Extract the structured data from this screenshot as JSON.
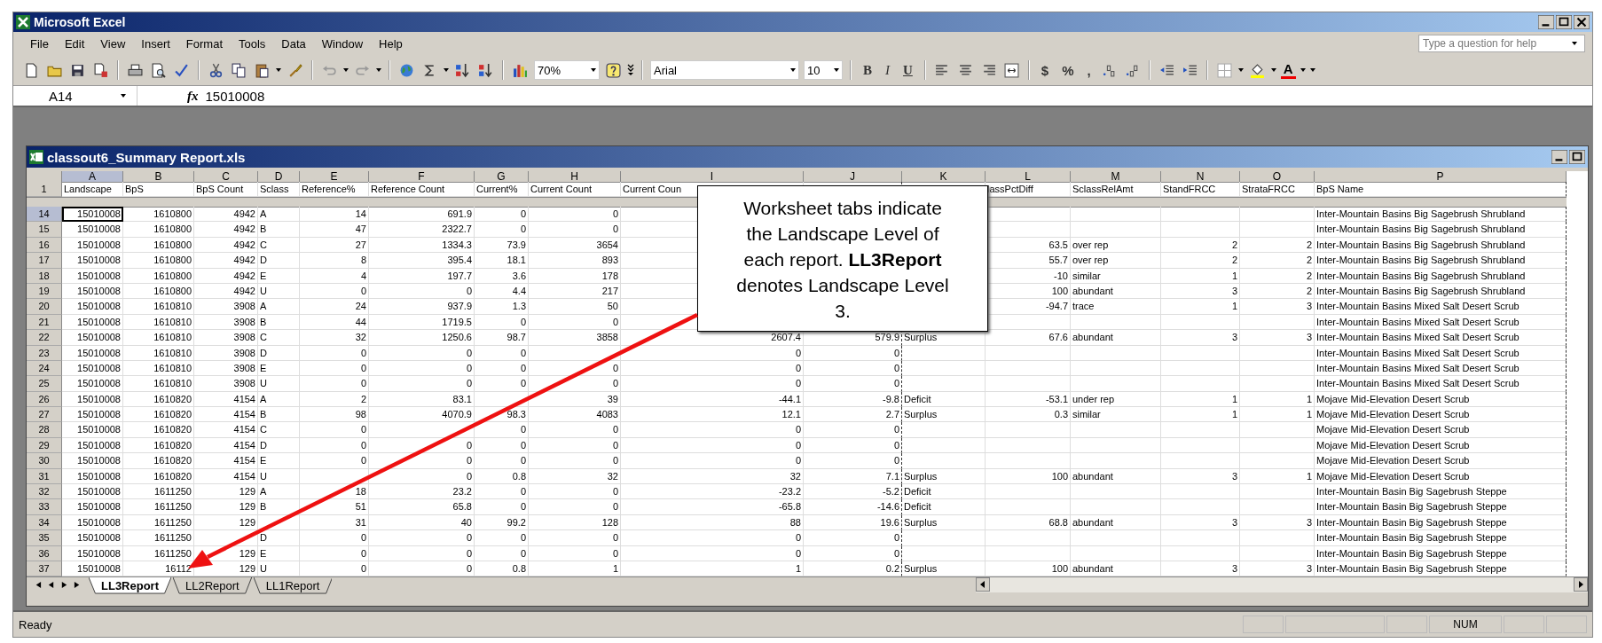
{
  "window": {
    "title": "Microsoft Excel"
  },
  "menu": [
    "File",
    "Edit",
    "View",
    "Insert",
    "Format",
    "Tools",
    "Data",
    "Window",
    "Help"
  ],
  "help_box": {
    "placeholder": "Type a question for help"
  },
  "toolbar": {
    "zoom": "70%",
    "font": "Arial",
    "font_size": "10",
    "style_buttons": [
      "B",
      "I",
      "U"
    ],
    "number_buttons": [
      "$",
      "%",
      ","
    ],
    "font_color_label": "A"
  },
  "formula_bar": {
    "name_box": "A14",
    "function_label": "fx",
    "value": "15010008"
  },
  "workbook": {
    "title": "classout6_Summary Report.xls",
    "columns": [
      {
        "letter": "A",
        "selected": true
      },
      {
        "letter": "B",
        "selected": false
      },
      {
        "letter": "C",
        "selected": false
      },
      {
        "letter": "D",
        "selected": false
      },
      {
        "letter": "E",
        "selected": false
      },
      {
        "letter": "F",
        "selected": false
      },
      {
        "letter": "G",
        "selected": false
      },
      {
        "letter": "H",
        "selected": false
      },
      {
        "letter": "I",
        "selected": false
      },
      {
        "letter": "J",
        "selected": false
      },
      {
        "letter": "K",
        "selected": false
      },
      {
        "letter": "L",
        "selected": false
      },
      {
        "letter": "M",
        "selected": false
      },
      {
        "letter": "N",
        "selected": false
      },
      {
        "letter": "O",
        "selected": false
      },
      {
        "letter": "P",
        "selected": false
      }
    ],
    "header_row": {
      "number": "1",
      "cells": [
        "Landscape",
        "BpS",
        "BpS Count",
        "Sclass",
        "Reference%",
        "Reference Count",
        "Current%",
        "Current Count",
        "Current Coun",
        "",
        "",
        "lassPctDiff",
        "SclassRelAmt",
        "StandFRCC",
        "StrataFRCC",
        "BpS Name"
      ]
    },
    "rows": [
      {
        "number": "14",
        "selected": true,
        "cells": [
          "15010008",
          "1610800",
          "4942",
          "A",
          "14",
          "691.9",
          "0",
          "0",
          "",
          "",
          "",
          "",
          "",
          "",
          "",
          "Inter-Mountain Basins Big Sagebrush Shrubland"
        ]
      },
      {
        "number": "15",
        "selected": false,
        "cells": [
          "15010008",
          "1610800",
          "4942",
          "B",
          "47",
          "2322.7",
          "0",
          "0",
          "",
          "",
          "",
          "",
          "",
          "",
          "",
          "Inter-Mountain Basins Big Sagebrush Shrubland"
        ]
      },
      {
        "number": "16",
        "selected": false,
        "cells": [
          "15010008",
          "1610800",
          "4942",
          "C",
          "27",
          "1334.3",
          "73.9",
          "3654",
          "",
          "",
          "",
          "63.5",
          "over rep",
          "2",
          "2",
          "Inter-Mountain Basins Big Sagebrush Shrubland"
        ]
      },
      {
        "number": "17",
        "selected": false,
        "cells": [
          "15010008",
          "1610800",
          "4942",
          "D",
          "8",
          "395.4",
          "18.1",
          "893",
          "",
          "",
          "",
          "55.7",
          "over rep",
          "2",
          "2",
          "Inter-Mountain Basins Big Sagebrush Shrubland"
        ]
      },
      {
        "number": "18",
        "selected": false,
        "cells": [
          "15010008",
          "1610800",
          "4942",
          "E",
          "4",
          "197.7",
          "3.6",
          "178",
          "",
          "",
          "",
          "-10",
          "similar",
          "1",
          "2",
          "Inter-Mountain Basins Big Sagebrush Shrubland"
        ]
      },
      {
        "number": "19",
        "selected": false,
        "cells": [
          "15010008",
          "1610800",
          "4942",
          "U",
          "0",
          "0",
          "4.4",
          "217",
          "",
          "",
          "",
          "100",
          "abundant",
          "3",
          "2",
          "Inter-Mountain Basins Big Sagebrush Shrubland"
        ]
      },
      {
        "number": "20",
        "selected": false,
        "cells": [
          "15010008",
          "1610810",
          "3908",
          "A",
          "24",
          "937.9",
          "1.3",
          "50",
          "",
          "",
          "",
          "-94.7",
          "trace",
          "1",
          "3",
          "Inter-Mountain Basins Mixed Salt Desert Scrub"
        ]
      },
      {
        "number": "21",
        "selected": false,
        "cells": [
          "15010008",
          "1610810",
          "3908",
          "B",
          "44",
          "1719.5",
          "0",
          "0",
          "",
          "",
          "",
          "",
          "",
          "",
          "",
          "Inter-Mountain Basins Mixed Salt Desert Scrub"
        ]
      },
      {
        "number": "22",
        "selected": false,
        "cells": [
          "15010008",
          "1610810",
          "3908",
          "C",
          "32",
          "1250.6",
          "98.7",
          "3858",
          "2607.4",
          "579.9",
          "Surplus",
          "67.6",
          "abundant",
          "3",
          "3",
          "Inter-Mountain Basins Mixed Salt Desert Scrub"
        ]
      },
      {
        "number": "23",
        "selected": false,
        "cells": [
          "15010008",
          "1610810",
          "3908",
          "D",
          "0",
          "0",
          "0",
          "",
          "0",
          "0",
          "",
          "",
          "",
          "",
          "",
          "Inter-Mountain Basins Mixed Salt Desert Scrub"
        ]
      },
      {
        "number": "24",
        "selected": false,
        "cells": [
          "15010008",
          "1610810",
          "3908",
          "E",
          "0",
          "0",
          "0",
          "0",
          "0",
          "0",
          "",
          "",
          "",
          "",
          "",
          "Inter-Mountain Basins Mixed Salt Desert Scrub"
        ]
      },
      {
        "number": "25",
        "selected": false,
        "cells": [
          "15010008",
          "1610810",
          "3908",
          "U",
          "0",
          "0",
          "0",
          "0",
          "0",
          "0",
          "",
          "",
          "",
          "",
          "",
          "Inter-Mountain Basins Mixed Salt Desert Scrub"
        ]
      },
      {
        "number": "26",
        "selected": false,
        "cells": [
          "15010008",
          "1610820",
          "4154",
          "A",
          "2",
          "83.1",
          "",
          "39",
          "-44.1",
          "-9.8",
          "Deficit",
          "-53.1",
          "under rep",
          "1",
          "1",
          "Mojave Mid-Elevation Desert Scrub"
        ]
      },
      {
        "number": "27",
        "selected": false,
        "cells": [
          "15010008",
          "1610820",
          "4154",
          "B",
          "98",
          "4070.9",
          "98.3",
          "4083",
          "12.1",
          "2.7",
          "Surplus",
          "0.3",
          "similar",
          "1",
          "1",
          "Mojave Mid-Elevation Desert Scrub"
        ]
      },
      {
        "number": "28",
        "selected": false,
        "cells": [
          "15010008",
          "1610820",
          "4154",
          "C",
          "0",
          "",
          "0",
          "0",
          "0",
          "0",
          "",
          "",
          "",
          "",
          "",
          "Mojave Mid-Elevation Desert Scrub"
        ]
      },
      {
        "number": "29",
        "selected": false,
        "cells": [
          "15010008",
          "1610820",
          "4154",
          "D",
          "0",
          "0",
          "0",
          "0",
          "0",
          "0",
          "",
          "",
          "",
          "",
          "",
          "Mojave Mid-Elevation Desert Scrub"
        ]
      },
      {
        "number": "30",
        "selected": false,
        "cells": [
          "15010008",
          "1610820",
          "4154",
          "E",
          "0",
          "0",
          "0",
          "0",
          "0",
          "0",
          "",
          "",
          "",
          "",
          "",
          "Mojave Mid-Elevation Desert Scrub"
        ]
      },
      {
        "number": "31",
        "selected": false,
        "cells": [
          "15010008",
          "1610820",
          "4154",
          "U",
          "",
          "0",
          "0.8",
          "32",
          "32",
          "7.1",
          "Surplus",
          "100",
          "abundant",
          "3",
          "1",
          "Mojave Mid-Elevation Desert Scrub"
        ]
      },
      {
        "number": "32",
        "selected": false,
        "cells": [
          "15010008",
          "1611250",
          "129",
          "A",
          "18",
          "23.2",
          "0",
          "0",
          "-23.2",
          "-5.2",
          "Deficit",
          "",
          "",
          "",
          "",
          "Inter-Mountain Basin Big Sagebrush Steppe"
        ]
      },
      {
        "number": "33",
        "selected": false,
        "cells": [
          "15010008",
          "1611250",
          "129",
          "B",
          "51",
          "65.8",
          "0",
          "0",
          "-65.8",
          "-14.6",
          "Deficit",
          "",
          "",
          "",
          "",
          "Inter-Mountain Basin Big Sagebrush Steppe"
        ]
      },
      {
        "number": "34",
        "selected": false,
        "cells": [
          "15010008",
          "1611250",
          "129",
          "",
          "31",
          "40",
          "99.2",
          "128",
          "88",
          "19.6",
          "Surplus",
          "68.8",
          "abundant",
          "3",
          "3",
          "Inter-Mountain Basin Big Sagebrush Steppe"
        ]
      },
      {
        "number": "35",
        "selected": false,
        "cells": [
          "15010008",
          "1611250",
          "",
          "D",
          "0",
          "0",
          "0",
          "0",
          "0",
          "0",
          "",
          "",
          "",
          "",
          "",
          "Inter-Mountain Basin Big Sagebrush Steppe"
        ]
      },
      {
        "number": "36",
        "selected": false,
        "cells": [
          "15010008",
          "1611250",
          "129",
          "E",
          "0",
          "0",
          "0",
          "0",
          "0",
          "0",
          "",
          "",
          "",
          "",
          "",
          "Inter-Mountain Basin Big Sagebrush Steppe"
        ]
      },
      {
        "number": "37",
        "selected": false,
        "cells": [
          "15010008",
          "16112",
          "129",
          "U",
          "0",
          "0",
          "0.8",
          "1",
          "1",
          "0.2",
          "Surplus",
          "100",
          "abundant",
          "3",
          "3",
          "Inter-Mountain Basin Big Sagebrush Steppe"
        ]
      }
    ],
    "sheet_tabs": [
      {
        "label": "LL3Report",
        "selected": true
      },
      {
        "label": "LL2Report",
        "selected": false
      },
      {
        "label": "LL1Report",
        "selected": false
      }
    ]
  },
  "callout": "Worksheet tabs indicate the Landscape Level of each report.  **LL3Report** denotes Landscape Level 3.",
  "status_bar": {
    "status": "Ready",
    "indicator": "NUM"
  }
}
